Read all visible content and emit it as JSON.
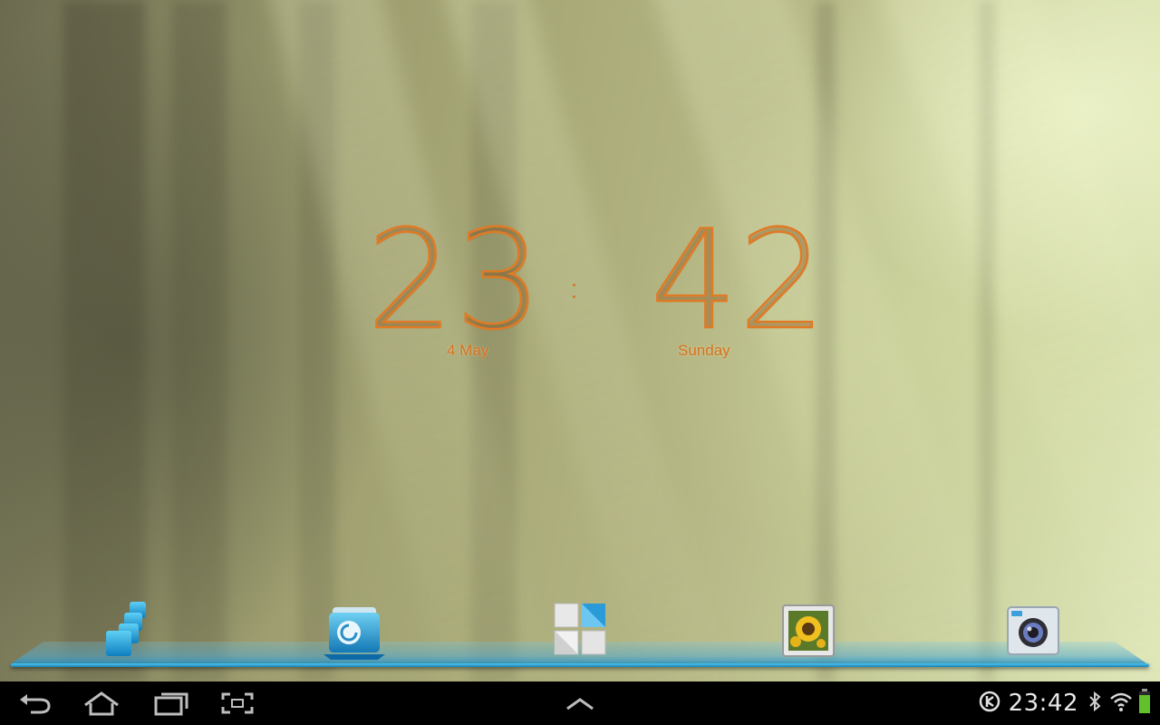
{
  "clock": {
    "hours": "23",
    "minutes": "42",
    "date": "4 May",
    "day": "Sunday",
    "color": "#e07a25"
  },
  "dock": {
    "items": [
      {
        "name": "apps-drawer",
        "icon": "blue-cubes-icon"
      },
      {
        "name": "file-manager",
        "icon": "folder-icon"
      },
      {
        "name": "launcher",
        "icon": "tiles-icon"
      },
      {
        "name": "gallery",
        "icon": "sunflower-photo-icon"
      },
      {
        "name": "camera",
        "icon": "camera-icon"
      }
    ],
    "accent": "#3ab6e6"
  },
  "navigation": {
    "buttons": [
      "back-icon",
      "home-icon",
      "recent-apps-icon",
      "screenshot-icon",
      "up-chevron-icon"
    ]
  },
  "status_bar": {
    "time": "23:42",
    "icons": [
      "sync-icon",
      "bluetooth-icon",
      "wifi-icon",
      "battery-icon"
    ],
    "battery_level": 0.85,
    "battery_color": "#63c02d"
  }
}
